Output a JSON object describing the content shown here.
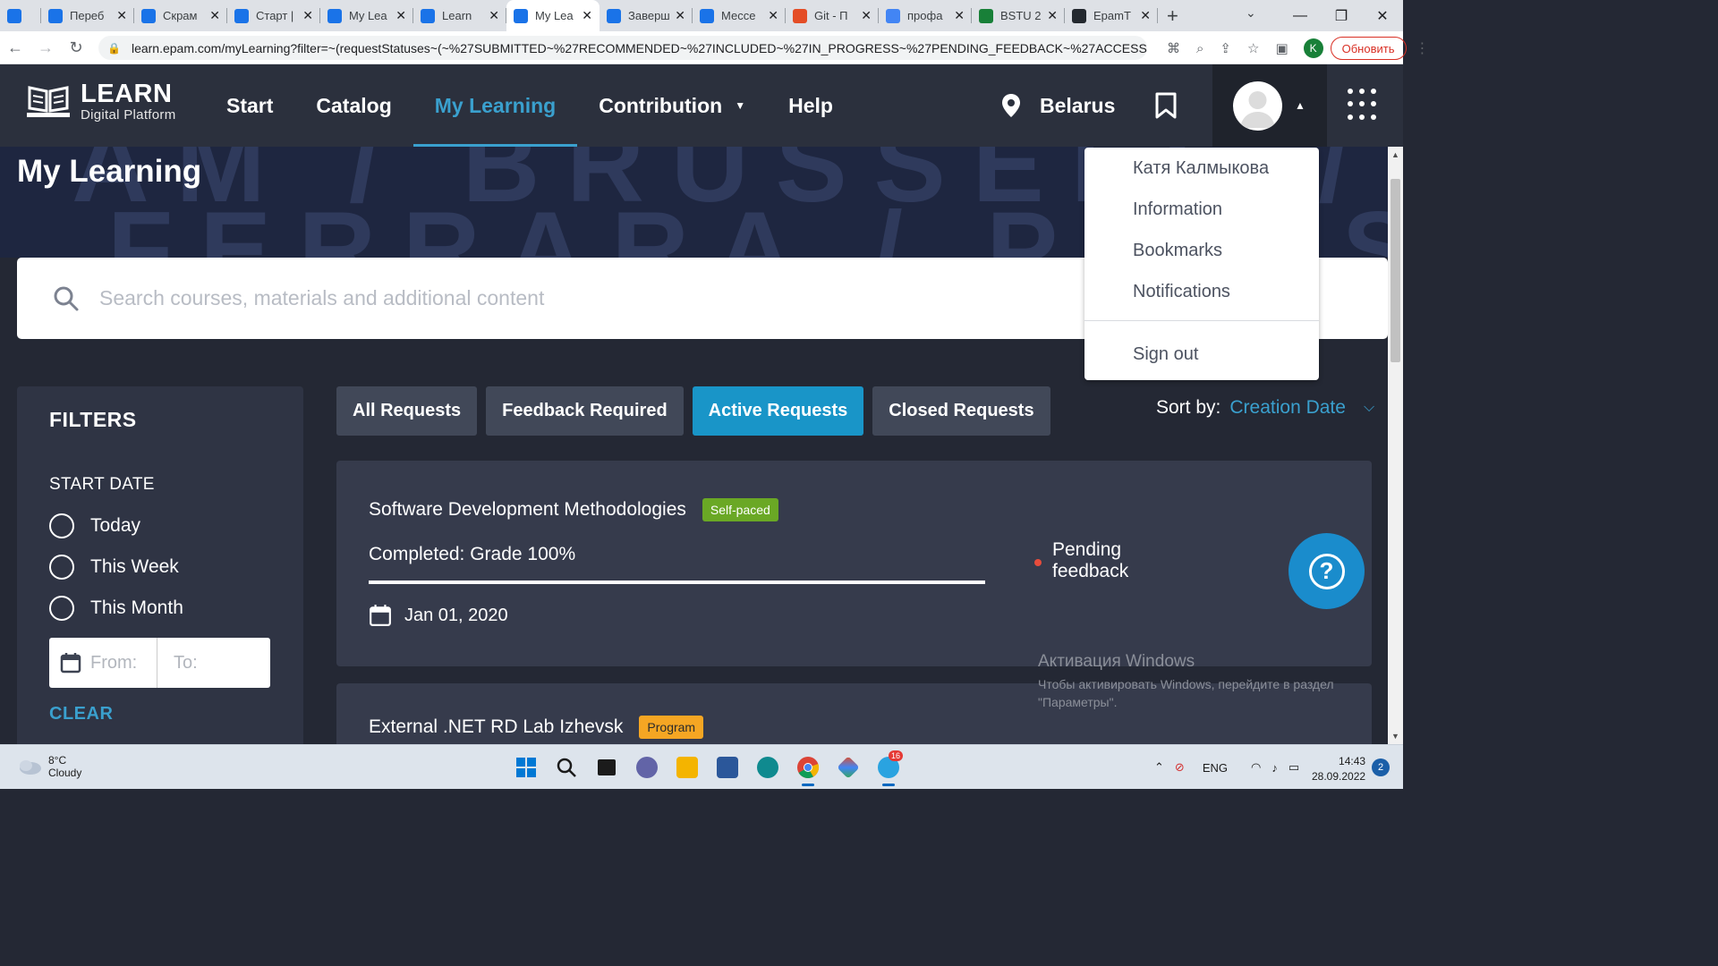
{
  "browser": {
    "tabs": [
      {
        "title": "",
        "color": "#1a73e8",
        "icon": "book-icon"
      },
      {
        "title": "Переб",
        "color": "#1a73e8",
        "icon": "circle-icon"
      },
      {
        "title": "Скрам",
        "color": "#1a73e8",
        "icon": "circle-icon"
      },
      {
        "title": "Старт |",
        "color": "#1a73e8",
        "icon": "book-icon"
      },
      {
        "title": "My Lea",
        "color": "#1a73e8",
        "icon": "book-icon"
      },
      {
        "title": "Learn",
        "color": "#1a73e8",
        "icon": "book-icon"
      },
      {
        "title": "My Lea",
        "color": "#1a73e8",
        "icon": "book-icon",
        "active": true
      },
      {
        "title": "Заверш",
        "color": "#1a73e8",
        "icon": "circle-icon"
      },
      {
        "title": "Мессе",
        "color": "#1a73e8",
        "icon": "chat-icon"
      },
      {
        "title": "Git - П",
        "color": "#e44d26",
        "icon": "git-icon"
      },
      {
        "title": "профа",
        "color": "#4285f4",
        "icon": "google-icon"
      },
      {
        "title": "BSTU 2",
        "color": "#188038",
        "icon": "sheets-icon"
      },
      {
        "title": "EpamT",
        "color": "#24292f",
        "icon": "github-icon"
      }
    ],
    "url": "learn.epam.com/myLearning?filter=~(requestStatuses~(~%27SUBMITTED~%27RECOMMENDED~%27INCLUDED~%27IN_PROGRESS~%27PENDING_FEEDBACK~%27ACCESS...",
    "profile_letter": "K",
    "update_label": "Обновить"
  },
  "header": {
    "logo_title": "LEARN",
    "logo_subtitle": "Digital Platform",
    "nav": [
      {
        "label": "Start"
      },
      {
        "label": "Catalog"
      },
      {
        "label": "My Learning",
        "active": true
      },
      {
        "label": "Contribution",
        "dropdown": true
      },
      {
        "label": "Help"
      }
    ],
    "location": "Belarus"
  },
  "hero": {
    "title": "My Learning",
    "bg_line1": "AM / BRUSSELS / DU",
    "bg_line2": "FERRARA / PARIS / R"
  },
  "search": {
    "placeholder": "Search courses, materials and additional content"
  },
  "user_menu": {
    "name": "Катя Калмыкова",
    "items": [
      "Information",
      "Bookmarks",
      "Notifications"
    ],
    "signout": "Sign out"
  },
  "filters": {
    "title": "FILTERS",
    "section": "START DATE",
    "options": [
      "Today",
      "This Week",
      "This Month"
    ],
    "from_placeholder": "From:",
    "to_placeholder": "To:",
    "clear": "CLEAR"
  },
  "request_tabs": [
    {
      "label": "All Requests"
    },
    {
      "label": "Feedback Required"
    },
    {
      "label": "Active Requests",
      "active": true
    },
    {
      "label": "Closed Requests"
    }
  ],
  "sort": {
    "label": "Sort by:",
    "value": "Creation Date"
  },
  "cards": [
    {
      "title": "Software Development Methodologies",
      "badge": "Self-paced",
      "grade": "Completed: Grade 100%",
      "progress": 1.0,
      "date": "Jan 01, 2020",
      "status_line1": "Pending",
      "status_line2": "feedback"
    },
    {
      "title": "External .NET RD Lab Izhevsk",
      "badge": "Program"
    }
  ],
  "watermark": {
    "line1": "Активация Windows",
    "line2": "Чтобы активировать Windows, перейдите в раздел \"Параметры\"."
  },
  "taskbar": {
    "temp": "8°C",
    "condition": "Cloudy",
    "lang": "ENG",
    "time": "14:43",
    "date": "28.09.2022",
    "notifications": "2",
    "telegram_badge": "16"
  }
}
